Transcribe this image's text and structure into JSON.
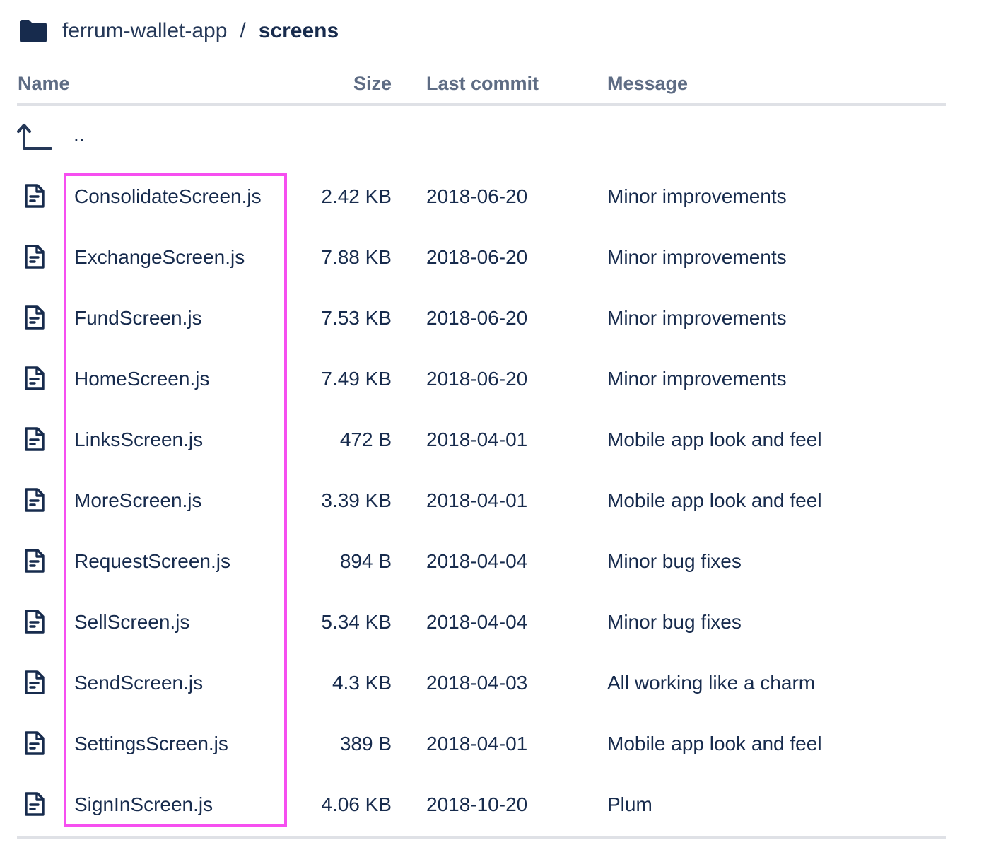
{
  "breadcrumb": {
    "repo": "ferrum-wallet-app",
    "separator": "/",
    "current": "screens"
  },
  "table": {
    "headers": {
      "name": "Name",
      "size": "Size",
      "last_commit": "Last commit",
      "message": "Message"
    },
    "parent_label": "..",
    "rows": [
      {
        "name": "ConsolidateScreen.js",
        "size": "2.42 KB",
        "last_commit": "2018-06-20",
        "message": "Minor improvements"
      },
      {
        "name": "ExchangeScreen.js",
        "size": "7.88 KB",
        "last_commit": "2018-06-20",
        "message": "Minor improvements"
      },
      {
        "name": "FundScreen.js",
        "size": "7.53 KB",
        "last_commit": "2018-06-20",
        "message": "Minor improvements"
      },
      {
        "name": "HomeScreen.js",
        "size": "7.49 KB",
        "last_commit": "2018-06-20",
        "message": "Minor improvements"
      },
      {
        "name": "LinksScreen.js",
        "size": "472 B",
        "last_commit": "2018-04-01",
        "message": "Mobile app look and feel"
      },
      {
        "name": "MoreScreen.js",
        "size": "3.39 KB",
        "last_commit": "2018-04-01",
        "message": "Mobile app look and feel"
      },
      {
        "name": "RequestScreen.js",
        "size": "894 B",
        "last_commit": "2018-04-04",
        "message": "Minor bug fixes"
      },
      {
        "name": "SellScreen.js",
        "size": "5.34 KB",
        "last_commit": "2018-04-04",
        "message": "Minor bug fixes"
      },
      {
        "name": "SendScreen.js",
        "size": "4.3 KB",
        "last_commit": "2018-04-03",
        "message": "All working like a charm"
      },
      {
        "name": "SettingsScreen.js",
        "size": "389 B",
        "last_commit": "2018-04-01",
        "message": "Mobile app look and feel"
      },
      {
        "name": "SignInScreen.js",
        "size": "4.06 KB",
        "last_commit": "2018-10-20",
        "message": "Plum"
      }
    ]
  },
  "icons": {
    "folder": "folder-icon",
    "parent": "arrow-up-left-icon",
    "file": "file-document-icon"
  },
  "colors": {
    "text": "#172b4d",
    "header_text": "#5e6c84",
    "rule": "#dfe1e6",
    "highlight": "#f64ff0"
  }
}
